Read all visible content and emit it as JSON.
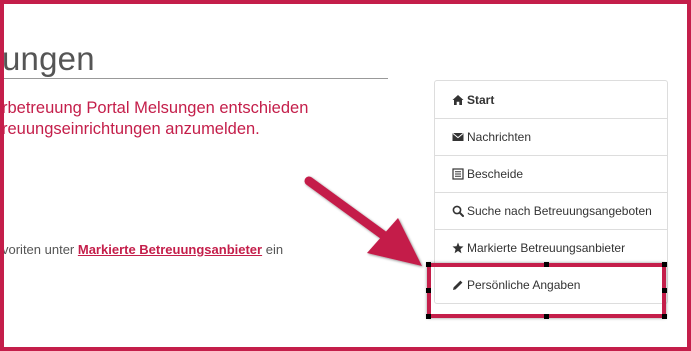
{
  "page": {
    "title": "ungen",
    "intro_lines": [
      "rbetreuung Portal Melsungen entschieden",
      "reuungseinrichtungen anzumelden."
    ],
    "favorites_prefix": "voriten unter ",
    "favorites_link": "Markierte Betreuungsanbieter",
    "favorites_suffix": " ein"
  },
  "nav": {
    "items": [
      {
        "label": "Start",
        "icon": "home-icon"
      },
      {
        "label": "Nachrichten",
        "icon": "envelope-icon"
      },
      {
        "label": "Bescheide",
        "icon": "document-list-icon"
      },
      {
        "label": "Suche nach Betreuungsangeboten",
        "icon": "search-icon"
      },
      {
        "label": "Markierte Betreuungsanbieter",
        "icon": "star-icon"
      },
      {
        "label": "Persönliche Angaben",
        "icon": "pencil-icon"
      }
    ]
  },
  "colors": {
    "accent": "#c41e4a",
    "text": "#555555",
    "border": "#dddddd"
  }
}
